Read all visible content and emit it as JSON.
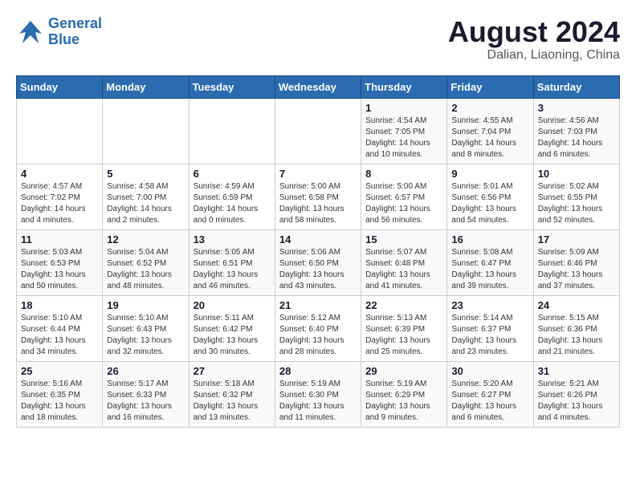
{
  "logo": {
    "line1": "General",
    "line2": "Blue"
  },
  "title": "August 2024",
  "location": "Dalian, Liaoning, China",
  "weekdays": [
    "Sunday",
    "Monday",
    "Tuesday",
    "Wednesday",
    "Thursday",
    "Friday",
    "Saturday"
  ],
  "weeks": [
    [
      {
        "day": "",
        "info": ""
      },
      {
        "day": "",
        "info": ""
      },
      {
        "day": "",
        "info": ""
      },
      {
        "day": "",
        "info": ""
      },
      {
        "day": "1",
        "info": "Sunrise: 4:54 AM\nSunset: 7:05 PM\nDaylight: 14 hours\nand 10 minutes."
      },
      {
        "day": "2",
        "info": "Sunrise: 4:55 AM\nSunset: 7:04 PM\nDaylight: 14 hours\nand 8 minutes."
      },
      {
        "day": "3",
        "info": "Sunrise: 4:56 AM\nSunset: 7:03 PM\nDaylight: 14 hours\nand 6 minutes."
      }
    ],
    [
      {
        "day": "4",
        "info": "Sunrise: 4:57 AM\nSunset: 7:02 PM\nDaylight: 14 hours\nand 4 minutes."
      },
      {
        "day": "5",
        "info": "Sunrise: 4:58 AM\nSunset: 7:00 PM\nDaylight: 14 hours\nand 2 minutes."
      },
      {
        "day": "6",
        "info": "Sunrise: 4:59 AM\nSunset: 6:59 PM\nDaylight: 14 hours\nand 0 minutes."
      },
      {
        "day": "7",
        "info": "Sunrise: 5:00 AM\nSunset: 6:58 PM\nDaylight: 13 hours\nand 58 minutes."
      },
      {
        "day": "8",
        "info": "Sunrise: 5:00 AM\nSunset: 6:57 PM\nDaylight: 13 hours\nand 56 minutes."
      },
      {
        "day": "9",
        "info": "Sunrise: 5:01 AM\nSunset: 6:56 PM\nDaylight: 13 hours\nand 54 minutes."
      },
      {
        "day": "10",
        "info": "Sunrise: 5:02 AM\nSunset: 6:55 PM\nDaylight: 13 hours\nand 52 minutes."
      }
    ],
    [
      {
        "day": "11",
        "info": "Sunrise: 5:03 AM\nSunset: 6:53 PM\nDaylight: 13 hours\nand 50 minutes."
      },
      {
        "day": "12",
        "info": "Sunrise: 5:04 AM\nSunset: 6:52 PM\nDaylight: 13 hours\nand 48 minutes."
      },
      {
        "day": "13",
        "info": "Sunrise: 5:05 AM\nSunset: 6:51 PM\nDaylight: 13 hours\nand 46 minutes."
      },
      {
        "day": "14",
        "info": "Sunrise: 5:06 AM\nSunset: 6:50 PM\nDaylight: 13 hours\nand 43 minutes."
      },
      {
        "day": "15",
        "info": "Sunrise: 5:07 AM\nSunset: 6:48 PM\nDaylight: 13 hours\nand 41 minutes."
      },
      {
        "day": "16",
        "info": "Sunrise: 5:08 AM\nSunset: 6:47 PM\nDaylight: 13 hours\nand 39 minutes."
      },
      {
        "day": "17",
        "info": "Sunrise: 5:09 AM\nSunset: 6:46 PM\nDaylight: 13 hours\nand 37 minutes."
      }
    ],
    [
      {
        "day": "18",
        "info": "Sunrise: 5:10 AM\nSunset: 6:44 PM\nDaylight: 13 hours\nand 34 minutes."
      },
      {
        "day": "19",
        "info": "Sunrise: 5:10 AM\nSunset: 6:43 PM\nDaylight: 13 hours\nand 32 minutes."
      },
      {
        "day": "20",
        "info": "Sunrise: 5:11 AM\nSunset: 6:42 PM\nDaylight: 13 hours\nand 30 minutes."
      },
      {
        "day": "21",
        "info": "Sunrise: 5:12 AM\nSunset: 6:40 PM\nDaylight: 13 hours\nand 28 minutes."
      },
      {
        "day": "22",
        "info": "Sunrise: 5:13 AM\nSunset: 6:39 PM\nDaylight: 13 hours\nand 25 minutes."
      },
      {
        "day": "23",
        "info": "Sunrise: 5:14 AM\nSunset: 6:37 PM\nDaylight: 13 hours\nand 23 minutes."
      },
      {
        "day": "24",
        "info": "Sunrise: 5:15 AM\nSunset: 6:36 PM\nDaylight: 13 hours\nand 21 minutes."
      }
    ],
    [
      {
        "day": "25",
        "info": "Sunrise: 5:16 AM\nSunset: 6:35 PM\nDaylight: 13 hours\nand 18 minutes."
      },
      {
        "day": "26",
        "info": "Sunrise: 5:17 AM\nSunset: 6:33 PM\nDaylight: 13 hours\nand 16 minutes."
      },
      {
        "day": "27",
        "info": "Sunrise: 5:18 AM\nSunset: 6:32 PM\nDaylight: 13 hours\nand 13 minutes."
      },
      {
        "day": "28",
        "info": "Sunrise: 5:19 AM\nSunset: 6:30 PM\nDaylight: 13 hours\nand 11 minutes."
      },
      {
        "day": "29",
        "info": "Sunrise: 5:19 AM\nSunset: 6:29 PM\nDaylight: 13 hours\nand 9 minutes."
      },
      {
        "day": "30",
        "info": "Sunrise: 5:20 AM\nSunset: 6:27 PM\nDaylight: 13 hours\nand 6 minutes."
      },
      {
        "day": "31",
        "info": "Sunrise: 5:21 AM\nSunset: 6:26 PM\nDaylight: 13 hours\nand 4 minutes."
      }
    ]
  ]
}
